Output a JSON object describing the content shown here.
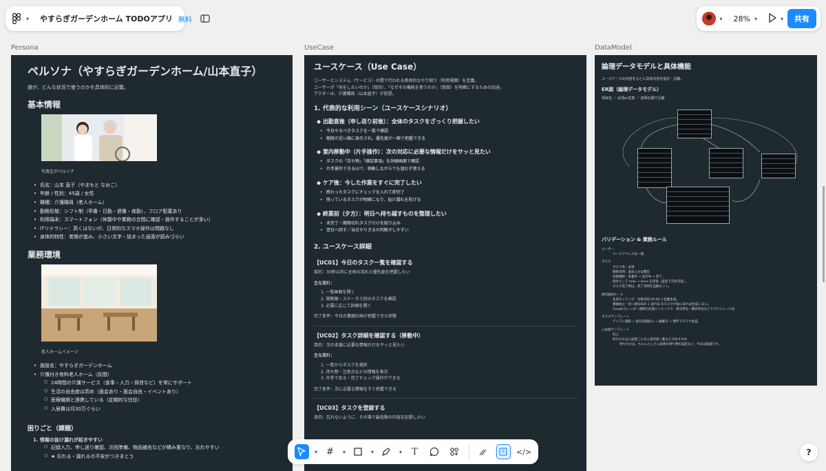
{
  "project": {
    "title": "やすらぎガーデンホーム TODOアプリ",
    "badge": "無料"
  },
  "topbar": {
    "zoom": "28%",
    "share_label": "共有"
  },
  "frames": {
    "persona_label": "Persona",
    "usecase_label": "UseCase",
    "datamodel_label": "DataModel"
  },
  "persona": {
    "title": "ペルソナ（やすらぎガーデンホーム/山本直子）",
    "intro": "誰が、どんな状況で使うのかを具体的に記載。",
    "basic_heading": "基本情報",
    "photo1_caption": "写真左がペルソナ",
    "basic": [
      "氏名：山本 直子（やまもと なおこ）",
      "年齢 / 性別：45歳 / 女性",
      "職種：介護職員（老人ホーム）",
      "勤務形態：シフト制（早番・日勤・遅番・夜勤）、フロア配置あり",
      "利用端末：スマートフォン（休憩中や業務の合間に確認・操作することが多い）",
      "ITリテラシー：高くはないが、日常的なスマホ操作は問題なし",
      "身体的特性：老眼が進み、小さい文字・詰まった画面が読みづらい"
    ],
    "work_heading": "業務環境",
    "photo2_caption": "老人ホームイメージ",
    "facility": [
      "施設名：やすらぎガーデンホーム",
      "介護付き有料老人ホーム（民間）"
    ],
    "facility_sub": [
      "24時間の介護サービス（食事・入力・排泄など）を常にサポート",
      "生活の自由度は高め（面会あり・面会自由・イベントあり）",
      "医療機関と連携している（定期的な往診）",
      "入居費は月30万ぐらい"
    ],
    "issue_heading": "困りごと（課題）",
    "issue1": "1. 情報の抜け漏れが起きやすい",
    "issue1_sub": [
      "記録入力、申し送り確認、次回準備、物品補充などが積み重なり、忘れやすい",
      "★ 忘れる・漏れるの不安がつきまとう"
    ]
  },
  "usecase": {
    "title": "ユースケース（Use Case）",
    "intro": [
      "ユーザーとシステム（サービス）の間で行われる具体的なやり取り（利用場面）を定義。",
      "ユーザーが「何をしたいのか」（目的）、「なぜその機能を使うのか」（意図）を明確にするための記述。",
      "アクターは、介護職員（山本直子）が前提。"
    ],
    "scenario_heading": "1. 代表的な利用シーン（ユースケースシナリオ）",
    "scenes": [
      {
        "title": "◆ 出勤直後（申し送り前後）：全体のタスクをざっくり把握したい",
        "items": [
          "今日やるべきタスクを一覧で確認",
          "期限が近い順に表示され、優先度が一瞬で把握できる"
        ]
      },
      {
        "title": "◆ 室内移動中（片手操作）：次の対応に必要な情報だけをサッと見たい",
        "items": [
          "タスクの「持ち物」「確認事項」を詳細画面で確認",
          "片手操作できるUIで、移動しながらでも迷わず使える"
        ]
      },
      {
        "title": "◆ ケア後：今した作業をすぐに完了したい",
        "items": [
          "終わったタスクにチェックを入れて即完了",
          "残っているタスクが明確になり、抜け漏れを防げる"
        ]
      },
      {
        "title": "◆ 終業前（夕方）：明日へ持ち越すものを整理したい",
        "items": [
          "未完了・期限切れタスクだけを絞り込み",
          "翌日へ回す／当日やりきるの判断がしやすい"
        ]
      }
    ],
    "detail_heading": "2. ユースケース詳細",
    "uc01": {
      "title": "【UC01】今日のタスク一覧を確認する",
      "goal": "目的：30秒以内に全体の流れと優先度を把握したい",
      "flow_label": "主な流れ：",
      "flow": [
        "1. 一覧画面を開く",
        "2. 期限順・ステータス別のタスクを確認",
        "3. 必要に応じて詳細を開く"
      ],
      "done": "完了条件：今日の業務計画が把握できた状態"
    },
    "uc02": {
      "title": "【UC02】タスク詳細を確認する（移動中）",
      "goal": "目的：次の支援に必要な情報だけをサッと見たい",
      "flow_label": "主な流れ：",
      "flow": [
        "1. 一覧からタスクを選択",
        "2. 持ち物・注意点などの情報を表示",
        "3. 片手で戻る・完了チェック操作ができる"
      ],
      "done": "完了条件：次に必要な情報をすぐ把握できる"
    },
    "uc03": {
      "title": "【UC03】タスクを登録する",
      "goal": "目的：忘れないように、その場で最低限の内容を記録したい"
    }
  },
  "datamodel": {
    "title": "論理データモデルと具体機能",
    "intro": "ユースケースの内容をもとに具体内容を設計・記載。",
    "er_heading": "ER図（論理データモデル）",
    "er_note": "項目名 ／ 必須or任意 ／ 説明の順で記載",
    "validation_heading": "バリデーション & 業務ルール",
    "rules": [
      {
        "label": "ユーザー",
        "items": [
          "メールアドレスは一意。"
        ]
      },
      {
        "label": "タスク",
        "items": [
          "タスク名：必須",
          "期限日時：過去入力は警告",
          "状態遷移：未着手 → 実行中 → 完了。",
          "例外として todo → done を許容（設定で方針可変）。",
          "タスク完了時は、完了日時を自動セット。"
        ]
      },
      {
        "label": "締切通知ルール",
        "items": [
          "生成タイミング：対象日前 00:00 に自動生成。",
          "重複防止：同一締切日の 1 実行日 のタスクが既にあれば生成しない。",
          "Googleカレンダー連携を前提にイメージで、新日単位・曜日単位などでスケジュール化"
        ]
      },
      {
        "label": "タスクテンプレート",
        "items": [
          "テンプレ選択 → 値を初期投入 → 編集可 → 保存でタスク生成。"
        ]
      },
      {
        "label": "入居者テンプレート",
        "items": [
          "同上",
          "持ちれたは入居者ごとの入退内容一覧などがおすすめ",
          "持ちれたは、ちゃんとした入居者の持ち物の設定など、今日は無理です。"
        ]
      }
    ]
  },
  "icons": {
    "figma": "figma-logo-icon",
    "sidebar": "sidebar-toggle-icon",
    "play": "play-icon",
    "help": "help-icon"
  },
  "accent": "#1a8cff",
  "frame_bg": "#1f2a30"
}
